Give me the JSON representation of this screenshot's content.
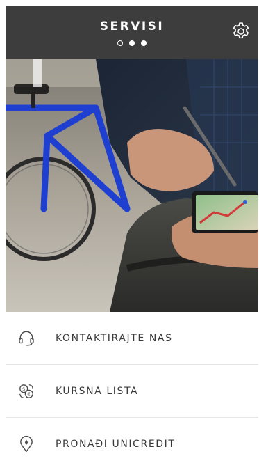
{
  "header": {
    "title": "SERVISI",
    "pager": {
      "count": 3,
      "active_index": 0
    },
    "settings_icon": "gear-icon",
    "background_color": "#3d3d3d"
  },
  "hero": {
    "image_content": "person holding navigation device beside blue bicycle"
  },
  "menu": {
    "items": [
      {
        "label": "KONTAKTIRAJTE NAS",
        "icon": "headset-icon"
      },
      {
        "label": "KURSNA LISTA",
        "icon": "currency-exchange-icon"
      },
      {
        "label": "PRONAĐI UNICREDIT",
        "icon": "location-pin-icon"
      }
    ]
  },
  "colors": {
    "text": "#3a3a3a",
    "divider": "#e6e6e6"
  }
}
